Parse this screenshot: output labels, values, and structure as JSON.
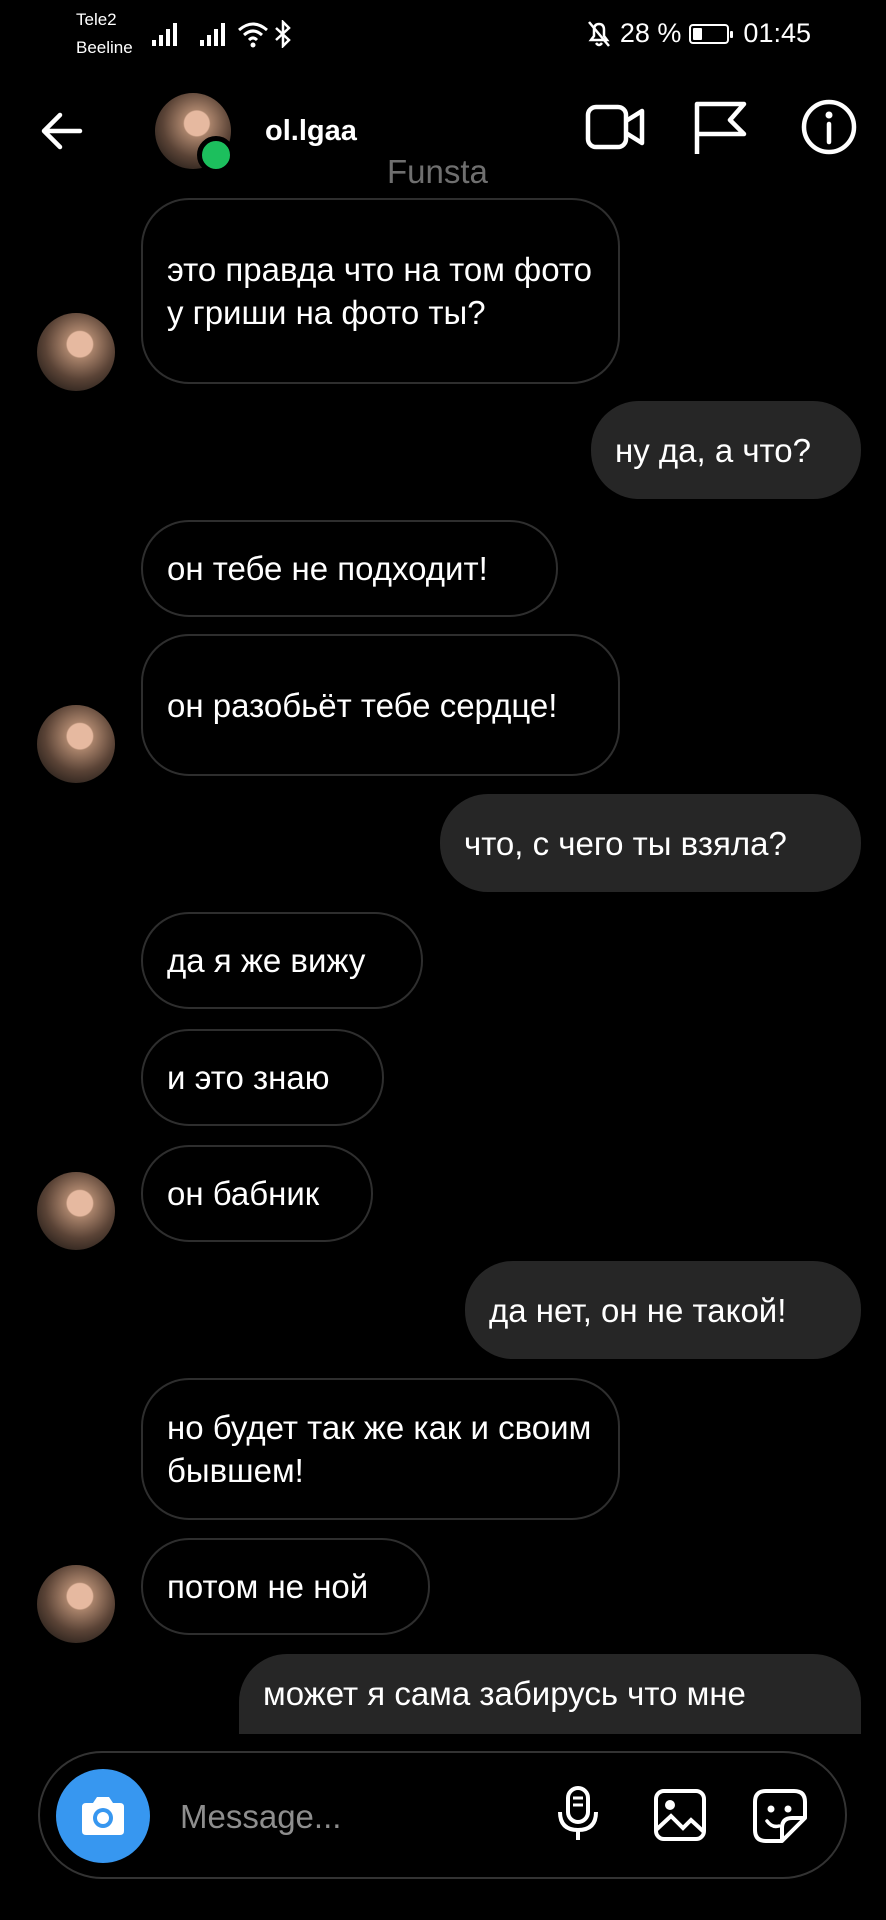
{
  "status_bar": {
    "carrier1": "Tele2",
    "carrier2": "Beeline",
    "battery": "28 %",
    "battery_level": 0.28,
    "time": "01:45"
  },
  "header": {
    "username": "ol.lgaa",
    "subtitle": "Funsta"
  },
  "messages": [
    {
      "side": "in",
      "text": "это правда что на том фото у гриши на фото ты?"
    },
    {
      "side": "out",
      "text": "ну да, а что?"
    },
    {
      "side": "in",
      "text": "он тебе не подходит!"
    },
    {
      "side": "in",
      "text": "он разобьёт тебе сердце!"
    },
    {
      "side": "out",
      "text": "что, с чего ты взяла?"
    },
    {
      "side": "in",
      "text": "да я же вижу"
    },
    {
      "side": "in",
      "text": "и это знаю"
    },
    {
      "side": "in",
      "text": "он бабник"
    },
    {
      "side": "out",
      "text": "да нет, он не такой!"
    },
    {
      "side": "in",
      "text": "но будет так же как и своим бывшем!"
    },
    {
      "side": "in",
      "text": "потом не ной"
    },
    {
      "side": "out",
      "text": "может я сама забирусь что мне"
    }
  ],
  "composer": {
    "placeholder": "Message..."
  },
  "colors": {
    "online": "#1cbf5d",
    "camera_button": "#3797f0",
    "outgoing_bubble": "#262626"
  }
}
